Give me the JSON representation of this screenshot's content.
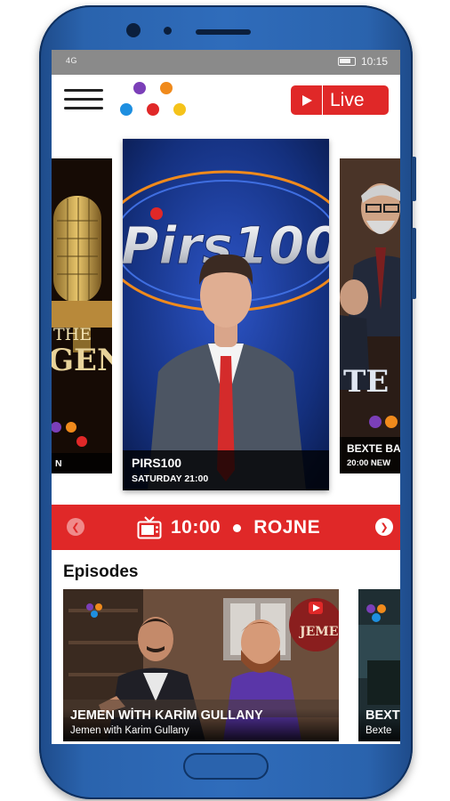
{
  "status_bar": {
    "signal_text": "4G",
    "time": "10:15"
  },
  "app_bar": {
    "menu_icon": "hamburger-menu-icon",
    "logo_icon": "channel-dots-logo",
    "live_label": "Live",
    "live_icon": "play-icon",
    "accent_color": "#e02828"
  },
  "carousel": {
    "posters": [
      {
        "title": "THE GENE",
        "subtitle": "N",
        "position": "left-partial"
      },
      {
        "title": "PIRS100",
        "subtitle": "SATURDAY 21:00",
        "art_text": "Pirs100",
        "position": "center"
      },
      {
        "title": "BEXTE BA",
        "subtitle": "20:00 NEW",
        "art_text": "TE",
        "position": "right-partial"
      }
    ]
  },
  "schedule": {
    "prev_icon": "chevron-left-icon",
    "next_icon": "chevron-right-icon",
    "tv_icon": "tv-icon",
    "time": "10:00",
    "show": "ROJNE"
  },
  "episodes": {
    "heading": "Episodes",
    "items": [
      {
        "title": "JEMEN WİTH KARİM GULLANY",
        "subtitle": "Jemen with Karim Gullany",
        "badge": "JEMEN X"
      },
      {
        "title": "BEXT",
        "subtitle": "Bexte"
      }
    ]
  }
}
